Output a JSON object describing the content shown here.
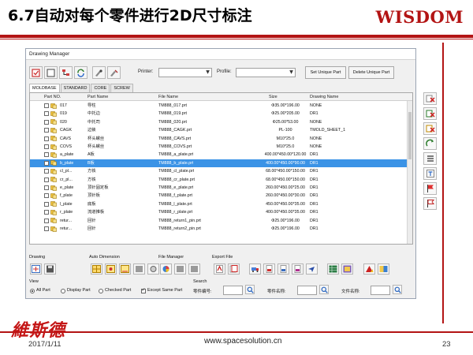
{
  "slide": {
    "title": "6.7自动对每个零件进行2D尺寸标注",
    "brand": "WISDOM",
    "logo_text": "維斯德",
    "date": "2017/1/11",
    "url": "www.spacesolution.cn",
    "page_number": "23"
  },
  "dialog": {
    "title": "Drawing Manager",
    "toolbar": {
      "printer_label": "Printer:",
      "profile_label": "Profile:",
      "printer_value": "",
      "profile_value": "",
      "set_unique_label": "Set Unique Part",
      "delete_unique_label": "Delete Unique Part"
    },
    "tabs": [
      "MOLDBASE",
      "STANDARD",
      "CORE",
      "SCREW"
    ],
    "active_tab": "MOLDBASE",
    "columns": [
      "Part NO.",
      "Part Name",
      "File Name",
      "Size",
      "Drawing Name"
    ],
    "rows": [
      {
        "no": "017",
        "name": "导柱",
        "file": "TM888_017.prt",
        "size": "Φ35.00*196.00",
        "drawing": "NONE"
      },
      {
        "no": "019",
        "name": "中托边",
        "file": "TM888_019.prt",
        "size": "Φ25.00*205.00",
        "drawing": "DR1"
      },
      {
        "no": "020",
        "name": "中托司",
        "file": "TM888_020.prt",
        "size": "Φ25.00*53.00",
        "drawing": "NONE"
      },
      {
        "no": "CAGK",
        "name": "边锁",
        "file": "TM888_CAGK.prt",
        "size": "PL-100",
        "drawing": "TMOLD_SHEET_1"
      },
      {
        "no": "CAVS",
        "name": "杯头螺丝",
        "file": "TM888_CAVS.prt",
        "size": "M10*25.0",
        "drawing": "NONE"
      },
      {
        "no": "COVS",
        "name": "杯头螺丝",
        "file": "TM888_COVS.prt",
        "size": "M10*25.0",
        "drawing": "NONE"
      },
      {
        "no": "a_plate",
        "name": "A板",
        "file": "TM888_a_plate.prt",
        "size": "400.00*450.00*120.00",
        "drawing": "DR1"
      },
      {
        "no": "b_plate",
        "name": "B板",
        "file": "TM888_b_plate.prt",
        "size": "400.00*450.00*90.00",
        "drawing": "DR1"
      },
      {
        "no": "cl_pl...",
        "name": "方铁",
        "file": "TM888_cl_plate.prt",
        "size": "68.00*450.00*150.00",
        "drawing": "DR1"
      },
      {
        "no": "cr_pl...",
        "name": "方铁",
        "file": "TM888_cr_plate.prt",
        "size": "68.00*450.00*150.00",
        "drawing": "DR1"
      },
      {
        "no": "e_plate",
        "name": "顶针固定板",
        "file": "TM888_e_plate.prt",
        "size": "260.00*450.00*25.00",
        "drawing": "DR1"
      },
      {
        "no": "f_plate",
        "name": "顶针板",
        "file": "TM888_f_plate.prt",
        "size": "260.00*450.00*30.00",
        "drawing": "DR1"
      },
      {
        "no": "l_plate",
        "name": "底板",
        "file": "TM888_l_plate.prt",
        "size": "450.00*450.00*35.00",
        "drawing": "DR1"
      },
      {
        "no": "r_plate",
        "name": "流道推板",
        "file": "TM888_r_plate.prt",
        "size": "400.00*450.00*35.00",
        "drawing": "DR1"
      },
      {
        "no": "retur...",
        "name": "回针",
        "file": "TM888_return1_pin.prt",
        "size": "Φ25.00*196.00",
        "drawing": "DR1"
      },
      {
        "no": "retur...",
        "name": "回针",
        "file": "TM888_return2_pin.prt",
        "size": "Φ25.00*196.00",
        "drawing": "DR1"
      }
    ],
    "selected_row": "b_plate",
    "groups": {
      "drawing": "Drawing",
      "auto_dimension": "Auto Dimension",
      "file_manager": "File Manager",
      "export_file": "Export File",
      "view": "View",
      "search": "Search"
    },
    "view_options": {
      "all_part": "All Part",
      "display_part": "Display Part",
      "checked_part": "Checked Part",
      "except_same_part": "Except Same Part"
    },
    "search": {
      "part_no_label": "零件编号:",
      "part_name_label": "零件名称:",
      "file_name_label": "文件名称:",
      "part_no_value": "",
      "part_name_value": "",
      "file_name_value": ""
    }
  },
  "colors": {
    "brand_red": "#b31414",
    "selection_blue": "#3b93e6"
  }
}
